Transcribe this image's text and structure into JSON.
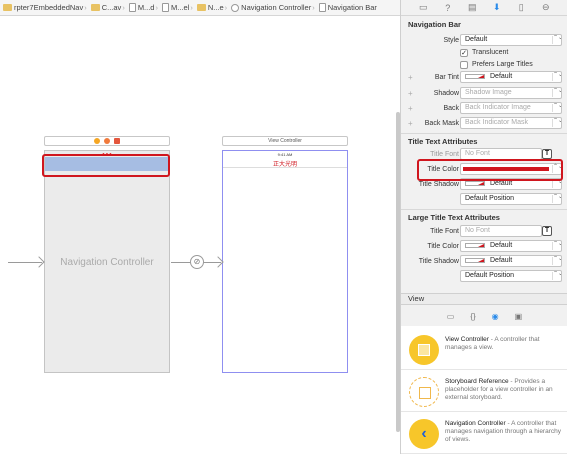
{
  "jumpbar": {
    "segments": [
      {
        "icon": "folder-icon",
        "label": "rpter7EmbeddedNav"
      },
      {
        "icon": "folder-icon",
        "label": "C...av"
      },
      {
        "icon": "file-icon",
        "label": "M...d"
      },
      {
        "icon": "file-icon",
        "label": "M...el"
      },
      {
        "icon": "folder-icon",
        "label": "N...e"
      },
      {
        "icon": "nav-controller-icon",
        "label": "Navigation Controller"
      },
      {
        "icon": "file-icon",
        "label": "Navigation Bar"
      }
    ]
  },
  "canvas": {
    "nav_scene_title": "Navigation Controller",
    "nav_status_text": "● ● ●",
    "vc_scene_bar_label": "View Controller",
    "vc_status_time": "9:41 AM",
    "vc_nav_title": "正大光明",
    "segue_icon": "⊘"
  },
  "inspector": {
    "tabs": [
      "file-icon",
      "help-icon",
      "identity-icon",
      "attributes-icon",
      "size-icon",
      "connections-icon"
    ],
    "nav_bar_section": "Navigation Bar",
    "style_label": "Style",
    "style_value": "Default",
    "translucent_label": "Translucent",
    "translucent_checked": true,
    "prefers_large_label": "Prefers Large Titles",
    "prefers_large_checked": false,
    "bar_tint_label": "Bar Tint",
    "bar_tint_value": "Default",
    "shadow_label": "Shadow",
    "shadow_placeholder": "Shadow Image",
    "back_label": "Back",
    "back_placeholder": "Back Indicator Image",
    "back_mask_label": "Back Mask",
    "back_mask_placeholder": "Back Indicator Mask",
    "title_text_section": "Title Text Attributes",
    "title_font_label": "Title Font",
    "title_font_placeholder": "No Font",
    "title_color_label": "Title Color",
    "title_color_hex": "#d0161e",
    "title_shadow_label": "Title Shadow",
    "title_shadow_value": "Default",
    "title_shadow_position": "Default Position",
    "large_title_section": "Large Title Text Attributes",
    "lt_font_label": "Title Font",
    "lt_font_placeholder": "No Font",
    "lt_color_label": "Title Color",
    "lt_color_value": "Default",
    "lt_shadow_label": "Title Shadow",
    "lt_shadow_value": "Default",
    "lt_shadow_position": "Default Position"
  },
  "library": {
    "header": "View",
    "tabs": [
      "file-icon",
      "braces-icon",
      "object-icon",
      "media-icon"
    ],
    "items": [
      {
        "name": "View Controller",
        "desc": " - A controller that manages a view."
      },
      {
        "name": "Storyboard Reference",
        "desc": " - Provides a placeholder for a view controller in an external storyboard."
      },
      {
        "name": "Navigation Controller",
        "desc": " - A controller that manages navigation through a hierarchy of views."
      }
    ]
  },
  "colors": {
    "highlight": "#d0161e",
    "nav_bar_fill": "#a6bde3",
    "selection_border": "#8f8ff0",
    "accent": "#2a8bea"
  }
}
